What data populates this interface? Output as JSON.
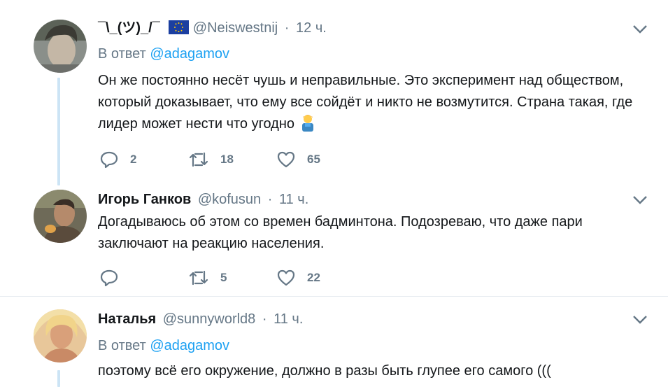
{
  "tweets": [
    {
      "display_name": "¯\\_(ツ)_/¯",
      "handle": "@Neiswestnij",
      "dot": "·",
      "time": "12 ч.",
      "reply_prefix": "В ответ",
      "reply_mention": "@adagamov",
      "text": "Он же постоянно несёт чушь и неправильные. Это эксперимент над обществом, который доказывает, что ему все сойдёт и никто не возмутится. Страна такая, где лидер может нести что угодно",
      "replies": "2",
      "retweets": "18",
      "likes": "65"
    },
    {
      "display_name": "Игорь Ганков",
      "handle": "@kofusun",
      "dot": "·",
      "time": "11 ч.",
      "text": "Догадываюсь об этом со времен бадминтона. Подозреваю, что даже пари заключают на реакцию населения.",
      "replies": "",
      "retweets": "5",
      "likes": "22"
    },
    {
      "display_name": "Наталья",
      "handle": "@sunnyworld8",
      "dot": "·",
      "time": "11 ч.",
      "reply_prefix": "В ответ",
      "reply_mention": "@adagamov",
      "text": "поэтому всё его окружение, должно в разы быть глупее его самого (((",
      "replies": "",
      "retweets": "",
      "likes": ""
    }
  ],
  "icons": {
    "flag": "eu-flag-icon",
    "emoji": "man-farmer-emoji-icon",
    "reply": "reply-icon",
    "retweet": "retweet-icon",
    "like": "heart-icon",
    "caret": "chevron-down-icon"
  },
  "colors": {
    "link": "#1da1f2",
    "secondary": "#657786",
    "thread_line": "#cce4f5",
    "divider": "#e6ecf0"
  }
}
